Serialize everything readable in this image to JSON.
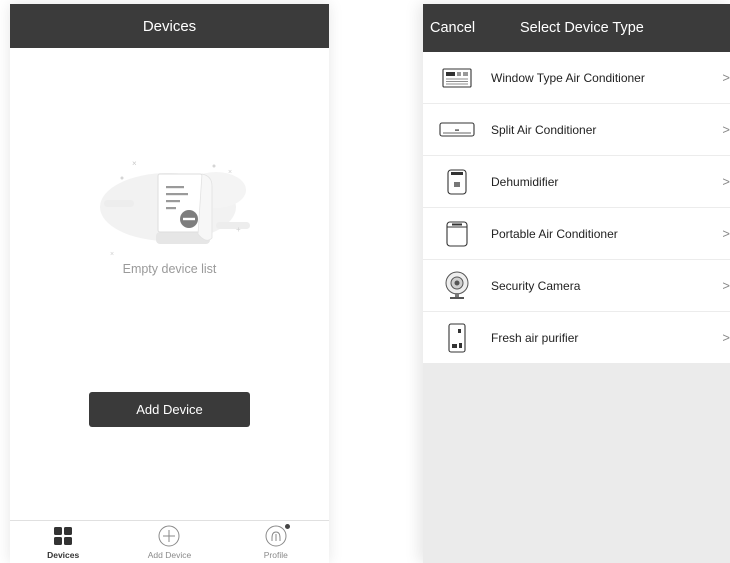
{
  "left": {
    "nav_title": "Devices",
    "empty_text": "Empty device list",
    "add_button": "Add Device",
    "tabs": [
      {
        "label": "Devices",
        "icon": "grid-icon"
      },
      {
        "label": "Add Device",
        "icon": "plus-circle-icon"
      },
      {
        "label": "Profile",
        "icon": "profile-icon"
      }
    ]
  },
  "right": {
    "cancel": "Cancel",
    "nav_title": "Select Device Type",
    "devices": [
      {
        "label": "Window Type Air Conditioner",
        "icon": "window-ac-icon"
      },
      {
        "label": "Split Air Conditioner",
        "icon": "split-ac-icon"
      },
      {
        "label": "Dehumidifier",
        "icon": "dehumidifier-icon"
      },
      {
        "label": "Portable Air Conditioner",
        "icon": "portable-ac-icon"
      },
      {
        "label": "Security Camera",
        "icon": "camera-icon"
      },
      {
        "label": "Fresh air purifier",
        "icon": "air-purifier-icon"
      }
    ],
    "chevron": ">"
  },
  "colors": {
    "nav_bg": "#3b3b3b",
    "button_bg": "#3a3a3a",
    "muted_text": "#9a9a9a",
    "panel_bg": "#ebebeb"
  }
}
